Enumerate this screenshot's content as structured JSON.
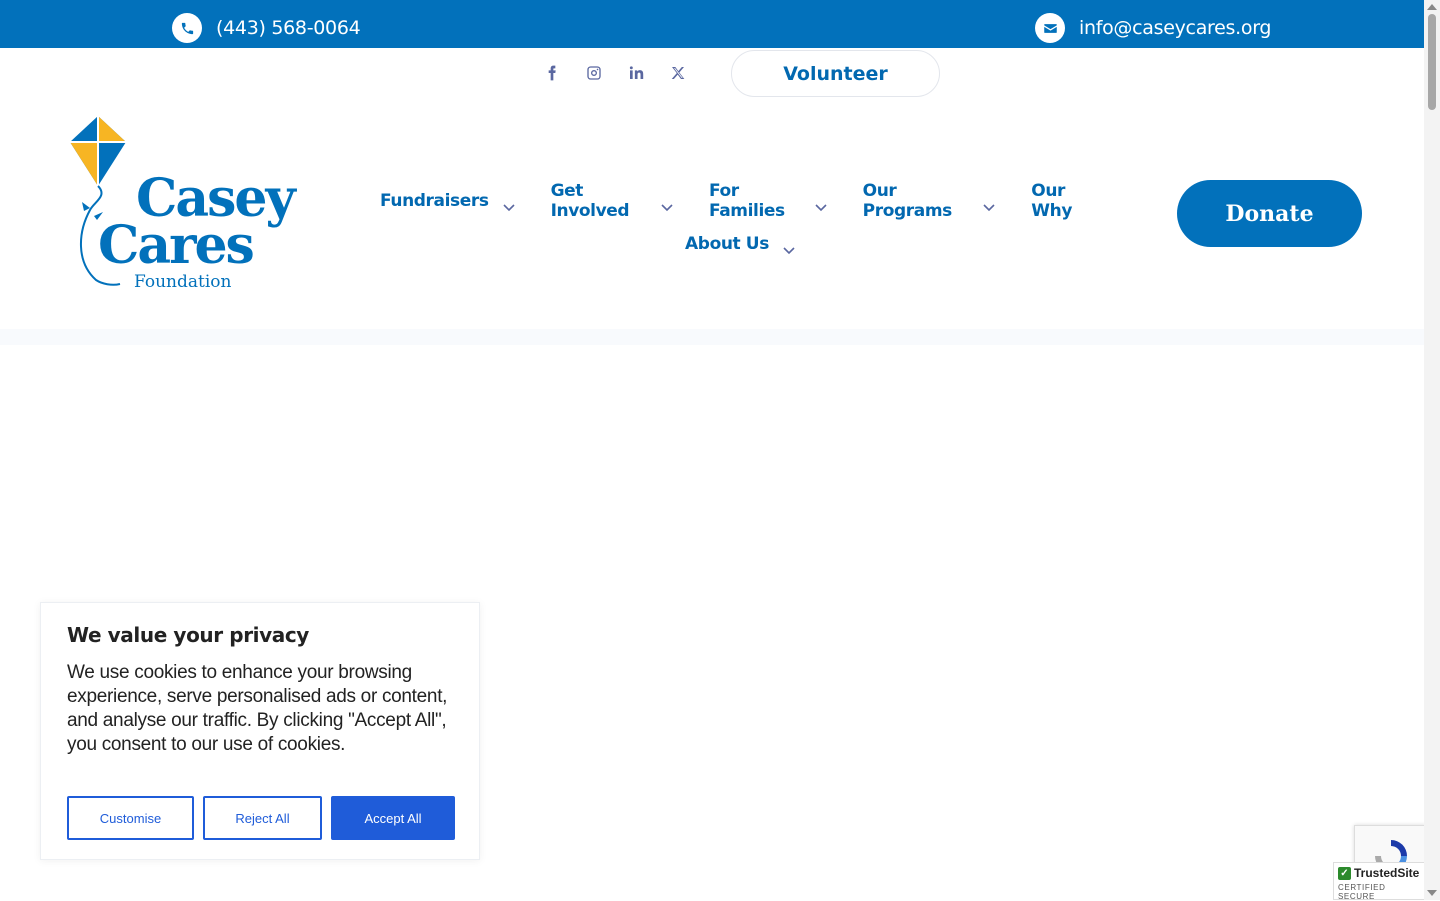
{
  "topbar": {
    "phone": "(443) 568-0064",
    "email": "info@caseycares.org",
    "phone_icon": "phone-icon",
    "email_icon": "envelope-icon",
    "color": "#0271bb"
  },
  "social": {
    "icons": [
      "facebook-icon",
      "instagram-icon",
      "linkedin-icon",
      "x-icon"
    ]
  },
  "volunteer_label": "Volunteer",
  "logo": {
    "line1": "Casey",
    "line2": "Cares",
    "line3": "Foundation"
  },
  "nav": {
    "items": [
      {
        "label": "Fundraisers",
        "has_dropdown": true
      },
      {
        "label": "Get Involved",
        "has_dropdown": true
      },
      {
        "label": "For Families",
        "has_dropdown": true
      },
      {
        "label": "Our Programs",
        "has_dropdown": true
      },
      {
        "label": "Our Why",
        "has_dropdown": false
      },
      {
        "label": "About Us",
        "has_dropdown": true
      }
    ]
  },
  "donate_label": "Donate",
  "cookie": {
    "title": "We value your privacy",
    "body": "We use cookies to enhance your browsing experience, serve personalised ads or content, and analyse our traffic. By clicking \"Accept All\", you consent to our use of cookies.",
    "customise": "Customise",
    "reject": "Reject All",
    "accept": "Accept All",
    "accent": "#1f5cd9"
  },
  "trusted": {
    "title": "TrustedSite",
    "subtitle": "CERTIFIED SECURE"
  }
}
